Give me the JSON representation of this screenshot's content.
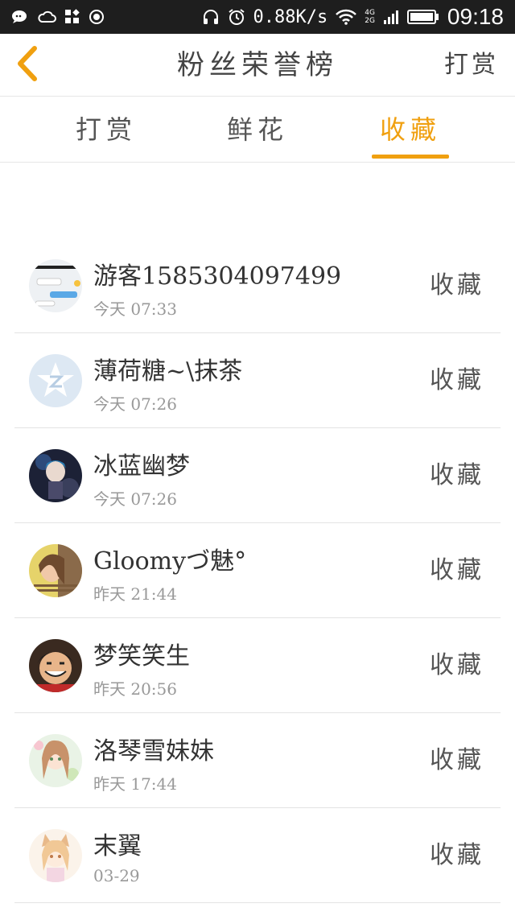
{
  "status_bar": {
    "net_speed": "0.88K/s",
    "net_type_top": "4G",
    "net_type_bottom": "2G",
    "time": "09:18"
  },
  "header": {
    "title": "粉丝荣誉榜",
    "action": "打赏"
  },
  "tabs": [
    {
      "label": "打赏",
      "active": false
    },
    {
      "label": "鲜花",
      "active": false
    },
    {
      "label": "收藏",
      "active": true
    }
  ],
  "colors": {
    "accent": "#f0a010",
    "status_bar": "#1e1e1e",
    "divider": "#e3e3e3"
  },
  "list": [
    {
      "name": "游客1585304097499",
      "time": "今天 07:33",
      "action": "收藏",
      "avatar": "chat-screenshot-avatar"
    },
    {
      "name": "薄荷糖~\\抹茶",
      "time": "今天 07:26",
      "action": "收藏",
      "avatar": "default-star-avatar"
    },
    {
      "name": "冰蓝幽梦",
      "time": "今天 07:26",
      "action": "收藏",
      "avatar": "anime-dark-avatar"
    },
    {
      "name": "Gloomyづ魅°",
      "time": "昨天 21:44",
      "action": "收藏",
      "avatar": "girl-photo-avatar"
    },
    {
      "name": "梦笑笑生",
      "time": "昨天 20:56",
      "action": "收藏",
      "avatar": "luffy-avatar"
    },
    {
      "name": "洛琴雪妹妹",
      "time": "昨天 17:44",
      "action": "收藏",
      "avatar": "anime-girl-avatar"
    },
    {
      "name": "末翼",
      "time": "03-29",
      "action": "收藏",
      "avatar": "anime-fox-girl-avatar"
    }
  ]
}
